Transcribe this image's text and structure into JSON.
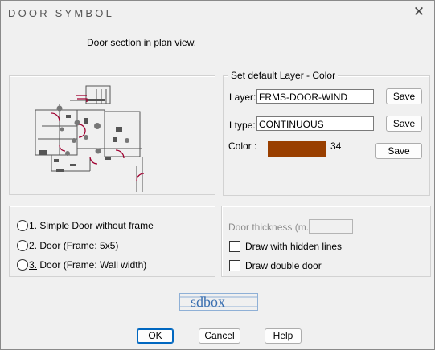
{
  "window": {
    "title": "DOOR SYMBOL",
    "close_glyph": "✕"
  },
  "description": "Door section in plan view.",
  "layer_group": {
    "title": "Set default Layer - Color",
    "layer_label": "Layer:",
    "layer_value": "FRMS-DOOR-WIND",
    "ltype_label": "Ltype:",
    "ltype_value": "CONTINUOUS",
    "color_label": "Color  :",
    "color_index": "34",
    "color_hex": "#993f00",
    "save_label": "Save"
  },
  "options": [
    {
      "number": "1.",
      "text": " Simple Door without frame"
    },
    {
      "number": "2.",
      "text": " Door (Frame: 5x5)"
    },
    {
      "number": "3.",
      "text": " Door (Frame: Wall width)"
    }
  ],
  "right_options": {
    "thickness_label": "Door thickness (m.):",
    "hidden_lines": "Draw with hidden lines",
    "double_door": "Draw double door"
  },
  "logo_text": "sdbox",
  "buttons": {
    "ok": "OK",
    "cancel": "Cancel",
    "help_u": "H",
    "help_rest": "elp"
  }
}
